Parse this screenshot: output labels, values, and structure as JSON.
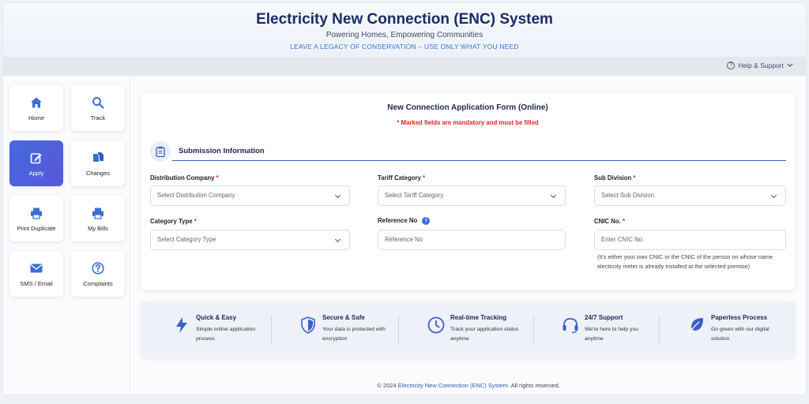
{
  "header": {
    "title": "Electricity New Connection (ENC) System",
    "subtitle": "Powering Homes, Empowering Communities",
    "tagline": "LEAVE A LEGACY OF CONSERVATION – USE ONLY WHAT YOU NEED"
  },
  "topbar": {
    "help_label": "Help & Support"
  },
  "sidebar": {
    "items": [
      {
        "label": "Home",
        "icon": "home-icon"
      },
      {
        "label": "Track",
        "icon": "search-icon"
      },
      {
        "label": "Apply",
        "icon": "edit-icon",
        "active": true
      },
      {
        "label": "Changes",
        "icon": "documents-icon"
      },
      {
        "label": "Print Duplicate",
        "icon": "printer-icon"
      },
      {
        "label": "My Bills",
        "icon": "printer-icon"
      },
      {
        "label": "SMS / Email",
        "icon": "mail-icon"
      },
      {
        "label": "Complaints",
        "icon": "question-icon"
      }
    ]
  },
  "form": {
    "title": "New Connection Application Form (Online)",
    "note": "* Marked fields are mandatory and must be filled",
    "section_title": "Submission Information",
    "fields": {
      "distribution_company": {
        "label": "Distribution Company",
        "required_mark": "*",
        "placeholder": "Select Distribution Company"
      },
      "tariff_category": {
        "label": "Tariff Category",
        "required_mark": "*",
        "placeholder": "Select Tariff Category"
      },
      "sub_division": {
        "label": "Sub Division",
        "required_mark": "*",
        "placeholder": "Select Sub Division"
      },
      "category_type": {
        "label": "Category Type",
        "required_mark": "*",
        "placeholder": "Select Category Type"
      },
      "reference_no": {
        "label": "Reference No",
        "placeholder": "Reference No"
      },
      "cnic": {
        "label": "CNIC No.",
        "required_mark": "*",
        "placeholder": "Enter CNIC No.",
        "hint": "(It's either your own CNIC or the CNIC of the person on whose name electricity meter is already installed at the selected premise)"
      }
    }
  },
  "features": [
    {
      "title": "Quick & Easy",
      "desc": "Simple online application process",
      "icon": "lightning-icon"
    },
    {
      "title": "Secure & Safe",
      "desc": "Your data is protected with encryption",
      "icon": "shield-icon"
    },
    {
      "title": "Real-time Tracking",
      "desc": "Track your application status anytime",
      "icon": "clock-icon"
    },
    {
      "title": "24/7 Support",
      "desc": "We're here to help you anytime",
      "icon": "headset-icon"
    },
    {
      "title": "Paperless Process",
      "desc": "Go green with our digital solution",
      "icon": "leaf-icon"
    }
  ],
  "footer": {
    "prefix": "© 2024",
    "brand": "Electricity New Connection (ENC) System",
    "suffix": ". All rights reserved."
  },
  "colors": {
    "accent": "#3b5fc6",
    "brand": "#1b2b63",
    "required": "#e02424",
    "active_tile": "#4a63de"
  }
}
